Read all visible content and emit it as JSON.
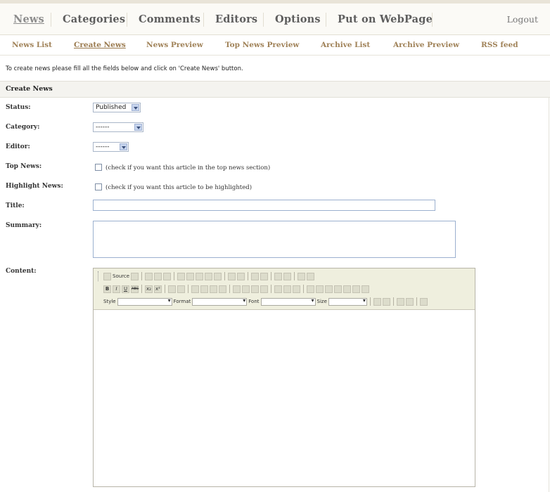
{
  "nav": {
    "items": [
      "News",
      "Categories",
      "Comments",
      "Editors",
      "Options",
      "Put on WebPage"
    ],
    "active": "News",
    "logout": "Logout"
  },
  "subnav": {
    "items": [
      "News List",
      "Create News",
      "News Preview",
      "Top News Preview",
      "Archive List",
      "Archive Preview",
      "RSS feed"
    ],
    "active": "Create News"
  },
  "intro": "To create news please fill all the fields below and click on 'Create News' button.",
  "section_title": "Create News",
  "form": {
    "status": {
      "label": "Status:",
      "value": "Published"
    },
    "category": {
      "label": "Category:",
      "value": "------"
    },
    "editor": {
      "label": "Editor:",
      "value": "------"
    },
    "top_news": {
      "label": "Top News:",
      "text": "(check if you want this article in the top news section)",
      "checked": false
    },
    "highlight_news": {
      "label": "Highlight News:",
      "text": "(check if you want this article to be highlighted)",
      "checked": false
    },
    "title": {
      "label": "Title:",
      "value": ""
    },
    "summary": {
      "label": "Summary:",
      "value": ""
    },
    "content": {
      "label": "Content:"
    }
  },
  "editor_toolbar": {
    "source_label": "Source",
    "style_label": "Style",
    "format_label": "Format",
    "font_label": "Font",
    "size_label": "Size",
    "bold": "B",
    "italic": "I",
    "underline": "U",
    "strike": "ABC",
    "subscript": "x₂",
    "superscript": "x²"
  }
}
